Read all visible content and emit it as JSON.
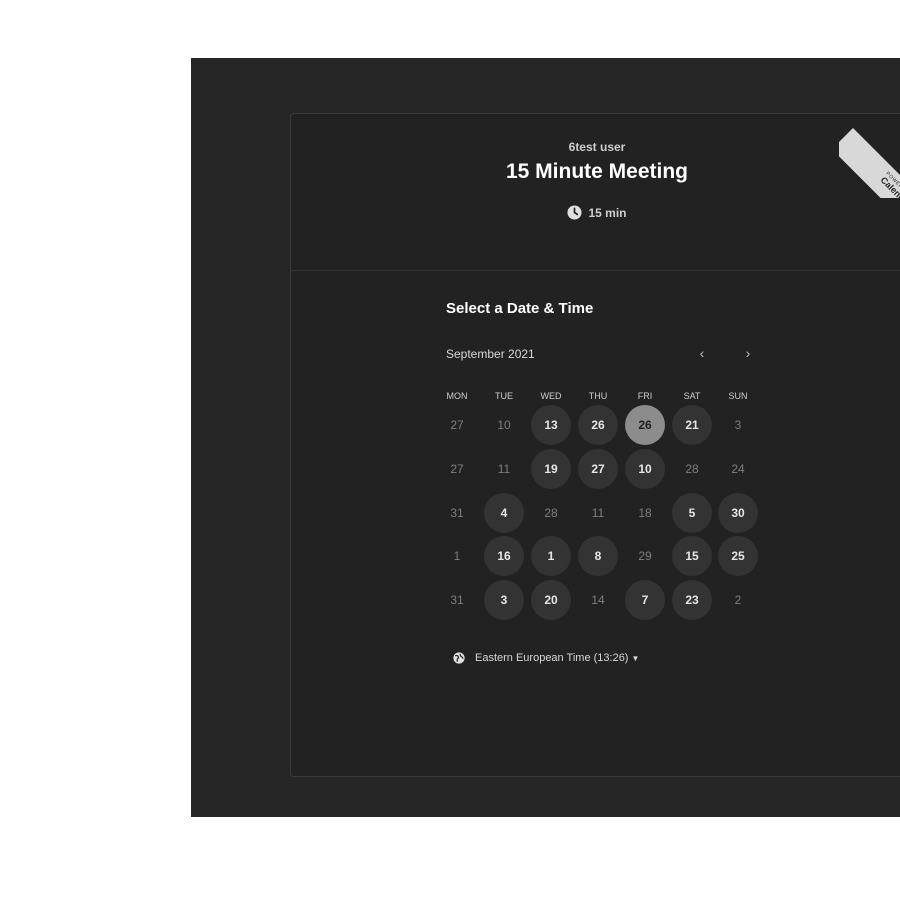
{
  "event": {
    "host": "6test user",
    "title": "15 Minute Meeting",
    "duration": "15 min"
  },
  "ribbon": {
    "small": "POWERED BY",
    "brand": "Calendly"
  },
  "calendar": {
    "section_title": "Select a Date & Time",
    "month_label": "September 2021",
    "prev_label": "‹",
    "next_label": "›",
    "weekdays": [
      "MON",
      "TUE",
      "WED",
      "THU",
      "FRI",
      "SAT",
      "SUN"
    ],
    "weeks": [
      [
        {
          "d": "27",
          "s": "plain"
        },
        {
          "d": "10",
          "s": "plain"
        },
        {
          "d": "13",
          "s": "avail"
        },
        {
          "d": "26",
          "s": "avail"
        },
        {
          "d": "26",
          "s": "sel"
        },
        {
          "d": "21",
          "s": "avail"
        },
        {
          "d": "3",
          "s": "plain"
        }
      ],
      [
        {
          "d": "27",
          "s": "plain"
        },
        {
          "d": "11",
          "s": "plain"
        },
        {
          "d": "19",
          "s": "avail"
        },
        {
          "d": "27",
          "s": "avail"
        },
        {
          "d": "10",
          "s": "avail"
        },
        {
          "d": "28",
          "s": "plain"
        },
        {
          "d": "24",
          "s": "plain"
        }
      ],
      [
        {
          "d": "31",
          "s": "plain"
        },
        {
          "d": "4",
          "s": "avail"
        },
        {
          "d": "28",
          "s": "plain"
        },
        {
          "d": "11",
          "s": "plain"
        },
        {
          "d": "18",
          "s": "plain"
        },
        {
          "d": "5",
          "s": "avail"
        },
        {
          "d": "30",
          "s": "avail"
        }
      ],
      [
        {
          "d": "1",
          "s": "plain"
        },
        {
          "d": "16",
          "s": "avail"
        },
        {
          "d": "1",
          "s": "avail"
        },
        {
          "d": "8",
          "s": "avail"
        },
        {
          "d": "29",
          "s": "plain"
        },
        {
          "d": "15",
          "s": "avail"
        },
        {
          "d": "25",
          "s": "avail"
        }
      ],
      [
        {
          "d": "31",
          "s": "plain"
        },
        {
          "d": "3",
          "s": "avail"
        },
        {
          "d": "20",
          "s": "avail"
        },
        {
          "d": "14",
          "s": "plain"
        },
        {
          "d": "7",
          "s": "avail"
        },
        {
          "d": "23",
          "s": "avail"
        },
        {
          "d": "2",
          "s": "plain"
        }
      ]
    ]
  },
  "timezone": {
    "label": "Eastern European Time (13:26)"
  },
  "colors": {
    "background": "#262626",
    "card": "#222222",
    "available_day": "#333333",
    "selected_day": "#8c8c8c"
  },
  "icons": {
    "clock": "clock-icon",
    "globe": "globe-icon"
  }
}
